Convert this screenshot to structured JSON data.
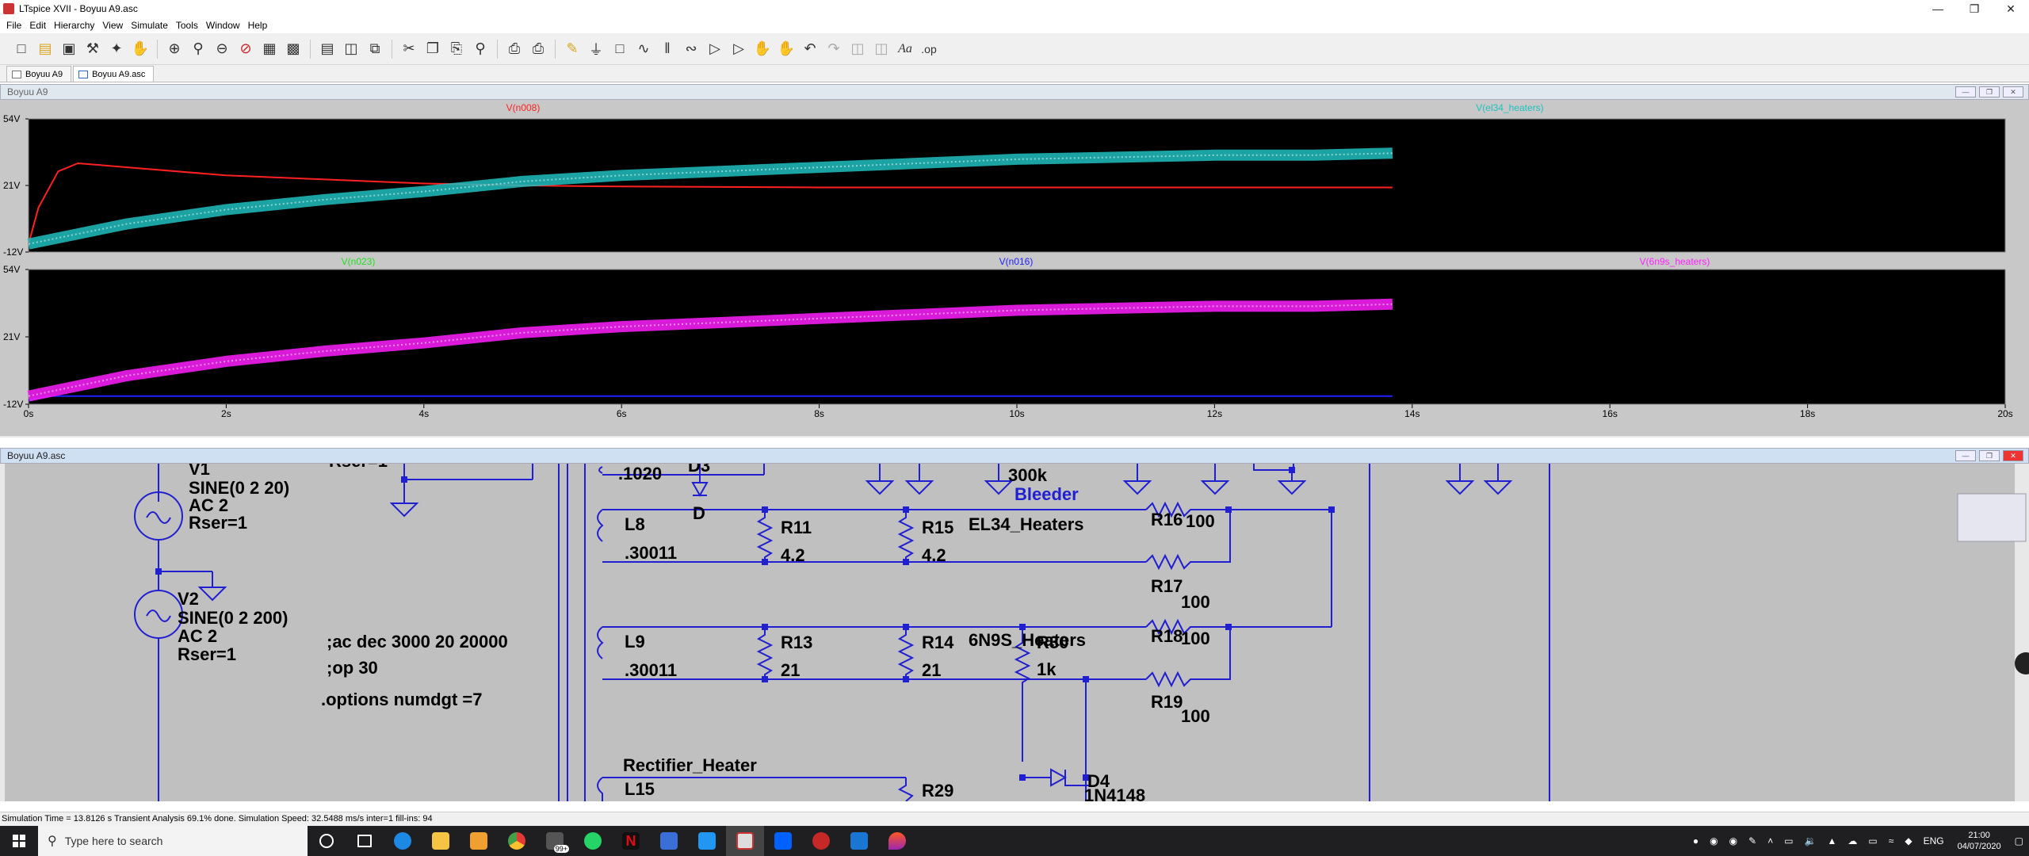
{
  "window": {
    "title": "LTspice XVII - Boyuu A9.asc"
  },
  "menu": [
    "File",
    "Edit",
    "Hierarchy",
    "View",
    "Simulate",
    "Tools",
    "Window",
    "Help"
  ],
  "tabs": [
    {
      "label": "Boyuu A9"
    },
    {
      "label": "Boyuu A9.asc"
    }
  ],
  "plot_window": {
    "title": "Boyuu A9"
  },
  "schematic_window": {
    "title": "Boyuu A9.asc"
  },
  "chart_data": [
    {
      "type": "line",
      "title": "",
      "series": [
        {
          "name": "V(n008)",
          "color": "#ff2020",
          "x": [
            0,
            0.1,
            0.3,
            0.5,
            1,
            2,
            3,
            4,
            5,
            6,
            8,
            10,
            12,
            13.8
          ],
          "y": [
            -8,
            10,
            28,
            32,
            30,
            26,
            24,
            22,
            21,
            20.5,
            20,
            20,
            20,
            20
          ]
        },
        {
          "name": "V(el34_heaters)",
          "color": "#20c0c0",
          "x": [
            0,
            1,
            2,
            3,
            4,
            5,
            6,
            7,
            8,
            9,
            10,
            11,
            12,
            13,
            13.8
          ],
          "y": [
            -8,
            2,
            9,
            14,
            18,
            23,
            26,
            28,
            30,
            32,
            34,
            35,
            36,
            36,
            37
          ]
        }
      ],
      "ylim": [
        -12,
        54
      ],
      "yticks": [
        "54V",
        "21V",
        "-12V"
      ],
      "xlim": [
        0,
        20
      ]
    },
    {
      "type": "line",
      "title": "",
      "series": [
        {
          "name": "V(n023)",
          "color": "#20e020",
          "x": [],
          "y": []
        },
        {
          "name": "V(n016)",
          "color": "#2020ff",
          "x": [
            0,
            0.2,
            1,
            2,
            13.8
          ],
          "y": [
            -10,
            -8,
            -8,
            -8,
            -8
          ]
        },
        {
          "name": "V(6n9s_heaters)",
          "color": "#ff20ff",
          "x": [
            0,
            1,
            2,
            3,
            4,
            5,
            6,
            7,
            8,
            9,
            10,
            11,
            12,
            13,
            13.8
          ],
          "y": [
            -8,
            2,
            9,
            14,
            18,
            23,
            26,
            28,
            30,
            32,
            34,
            35,
            36,
            36,
            37
          ]
        }
      ],
      "ylim": [
        -12,
        54
      ],
      "yticks": [
        "54V",
        "21V",
        "-12V"
      ],
      "xlim": [
        0,
        20
      ],
      "xticks": [
        "0s",
        "2s",
        "4s",
        "6s",
        "8s",
        "10s",
        "12s",
        "14s",
        "16s",
        "18s",
        "20s"
      ]
    }
  ],
  "schematic": {
    "labels": {
      "v1": "V1",
      "v1_val": "SINE(0 2 20)",
      "v1_ac": "AC 2",
      "v1_rser": "Rser=1",
      "v2": "V2",
      "v2_val": "SINE(0 2 200)",
      "v2_ac": "AC 2",
      "v2_rser": "Rser=1",
      "rser_top": "Rser=1",
      "dir_ac": ";ac dec 3000 20 20000",
      "dir_op": ";op 30",
      "dir_opt": ".options numdgt =7",
      "l_top_val": ".1020",
      "d3": "D3",
      "d3_val": "D",
      "r_top_val": "300k",
      "bleeder": "Bleeder",
      "el34": "EL34_Heaters",
      "l8": "L8",
      "l8_val": ".30011",
      "r11": "R11",
      "r11_val": "4.2",
      "r15": "R15",
      "r15_val": "4.2",
      "r16": "R16",
      "r16_val": "100",
      "r17": "R17",
      "r17_val": "100",
      "n9s": "6N9S_Heaters",
      "l9": "L9",
      "l9_val": ".30011",
      "r13": "R13",
      "r13_val": "21",
      "r14": "R14",
      "r14_val": "21",
      "r30": "R30",
      "r30_val": "1k",
      "r18": "R18",
      "r18_val": "100",
      "r19": "R19",
      "r19_val": "100",
      "rect": "Rectifier_Heater",
      "l15": "L15",
      "r29": "R29",
      "d4": "D4",
      "d4_val": "1N4148"
    }
  },
  "status": {
    "text": "Simulation Time = 13.8126 s  Transient Analysis 69.1% done. Simulation Speed: 32.5488 ms/s inter=1 fill-ins: 94"
  },
  "taskbar": {
    "search_placeholder": "Type here to search",
    "badge": "99+",
    "lang": "ENG",
    "time": "21:00",
    "date": "04/07/2020"
  }
}
